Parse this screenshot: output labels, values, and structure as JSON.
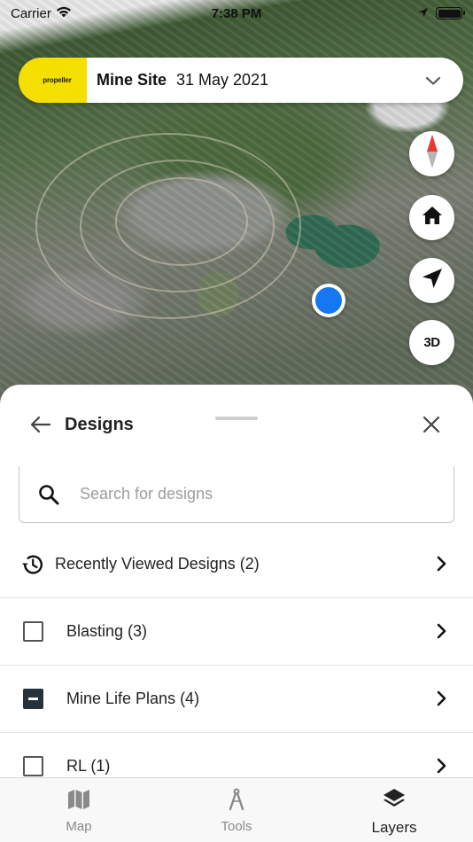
{
  "status_bar": {
    "carrier": "Carrier",
    "time": "7:38 PM"
  },
  "site": {
    "logo_text": "propeller",
    "name": "Mine Site",
    "date": "31 May 2021"
  },
  "map_controls": {
    "compass": "compass-icon",
    "home": "home-icon",
    "locate": "navigation-arrow-icon",
    "mode_3d_label": "3D"
  },
  "sheet": {
    "title": "Designs",
    "search_placeholder": "Search for designs",
    "recent": {
      "label": "Recently Viewed Designs (2)"
    },
    "items": [
      {
        "label": "Blasting (3)",
        "state": "unchecked"
      },
      {
        "label": "Mine Life Plans (4)",
        "state": "partial"
      },
      {
        "label": "RL (1)",
        "state": "unchecked"
      }
    ]
  },
  "tabs": [
    {
      "label": "Map",
      "icon": "map-icon",
      "active": false
    },
    {
      "label": "Tools",
      "icon": "compass-tool-icon",
      "active": false
    },
    {
      "label": "Layers",
      "icon": "layers-icon",
      "active": true
    }
  ],
  "colors": {
    "brand_yellow": "#f4df00",
    "location_blue": "#1677f2",
    "checkbox_dark": "#26323c"
  }
}
